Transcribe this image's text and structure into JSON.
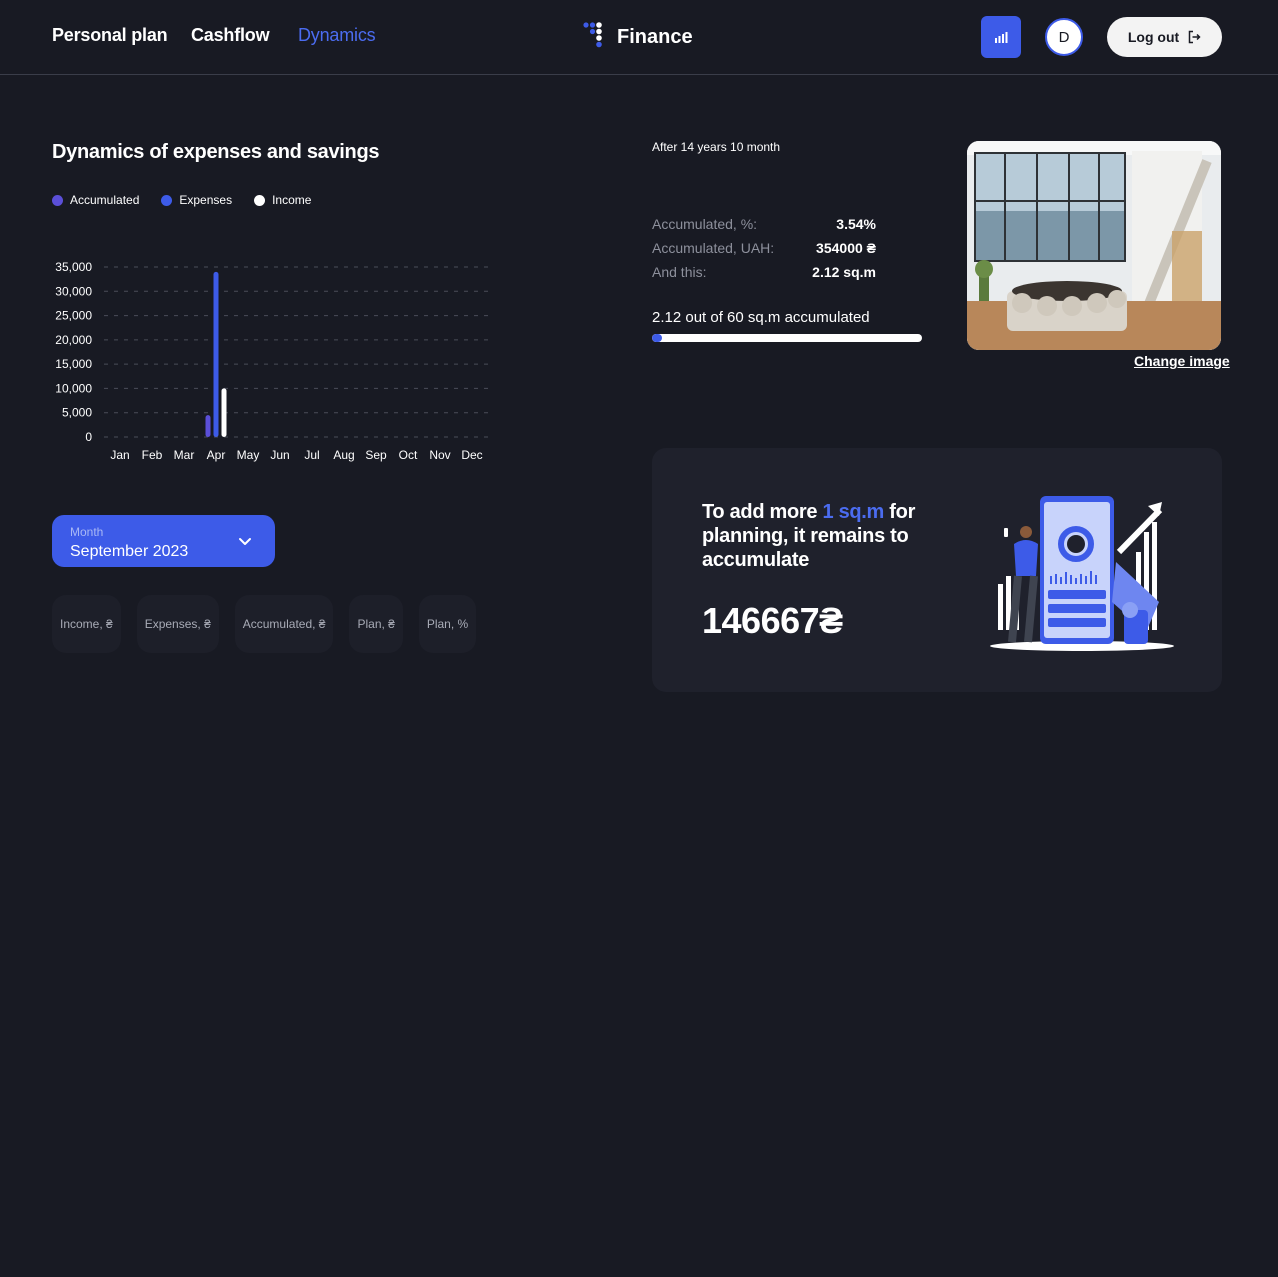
{
  "nav": {
    "personal_plan": "Personal plan",
    "cashflow": "Cashflow",
    "dynamics": "Dynamics"
  },
  "brand": {
    "name": "Finance",
    "accent": "#3d5be8"
  },
  "user": {
    "initial": "D"
  },
  "logout_label": "Log out",
  "chart_section": {
    "title": "Dynamics of expenses and savings",
    "legend": [
      {
        "label": "Accumulated",
        "color": "#5b4fd8"
      },
      {
        "label": "Expenses",
        "color": "#3d5be8"
      },
      {
        "label": "Income",
        "color": "#ffffff"
      }
    ]
  },
  "chart_data": {
    "type": "bar",
    "categories": [
      "Jan",
      "Feb",
      "Mar",
      "Apr",
      "May",
      "Jun",
      "Jul",
      "Aug",
      "Sep",
      "Oct",
      "Nov",
      "Dec"
    ],
    "series": [
      {
        "name": "Accumulated",
        "color": "#5b4fd8",
        "values": [
          0,
          0,
          0,
          4500,
          0,
          0,
          0,
          0,
          0,
          0,
          0,
          0
        ]
      },
      {
        "name": "Expenses",
        "color": "#3d5be8",
        "values": [
          0,
          0,
          0,
          34000,
          0,
          0,
          0,
          0,
          0,
          0,
          0,
          0
        ]
      },
      {
        "name": "Income",
        "color": "#ffffff",
        "values": [
          0,
          0,
          0,
          10000,
          0,
          0,
          0,
          0,
          0,
          0,
          0,
          0
        ]
      }
    ],
    "yticks": [
      "0",
      "5,000",
      "10,000",
      "15,000",
      "20,000",
      "25,000",
      "30,000",
      "35,000"
    ],
    "ylim": [
      0,
      35000
    ],
    "grid": true,
    "legend_position": "top-left"
  },
  "month_select": {
    "label": "Month",
    "value": "September 2023"
  },
  "table_headers": [
    "Income, ₴",
    "Expenses, ₴",
    "Accumulated, ₴",
    "Plan, ₴",
    "Plan, %"
  ],
  "summary": {
    "after": "After 14 years 10 month",
    "rows": [
      {
        "label": "Accumulated, %:",
        "value": "3.54%"
      },
      {
        "label": "Accumulated, UAH:",
        "value": "354000 ₴"
      },
      {
        "label": "And this:",
        "value": "2.12 sq.m"
      }
    ],
    "progress_label": "2.12 out of 60 sq.m accumulated",
    "progress_fraction": 0.0353,
    "change_image": "Change image"
  },
  "card": {
    "text_before": "To add more ",
    "text_accent": "1 sq.m",
    "text_after": " for planning, it remains to accumulate",
    "amount": "146667₴"
  }
}
